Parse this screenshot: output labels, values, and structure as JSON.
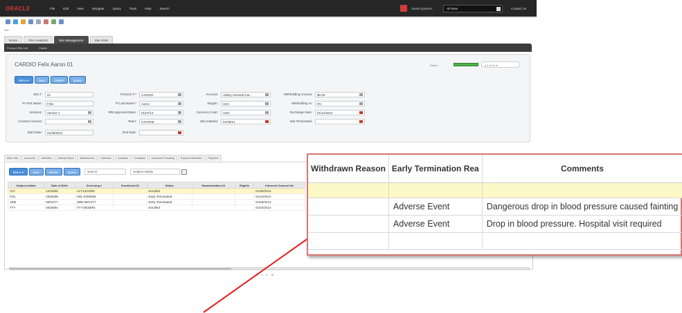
{
  "topbar": {
    "logo": "ORACLE",
    "menu": [
      "File",
      "Edit",
      "View",
      "Navigate",
      "Query",
      "Tools",
      "Help",
      "Search"
    ],
    "saved_queries_label": "Saved Queries:",
    "sites_value": "All Sites",
    "contact": "Contact Us"
  },
  "site_label": "Site",
  "main_tabs": [
    "Home",
    "OSA Analytics",
    "Site Management",
    "Site Visits"
  ],
  "sub_tabs": [
    "Protocol Site List",
    "Charts"
  ],
  "record": {
    "title": "CARDIO Felix Aaron 01",
    "status_label": "Status:",
    "pager": "1 of 1+",
    "buttons": {
      "menu": "Menu",
      "new": "New",
      "delete": "Delete",
      "query": "Query"
    }
  },
  "fields": {
    "site_no": {
      "label": "Site #:",
      "value": "01"
    },
    "pi_first": {
      "label": "PI First Name:",
      "value": "Felix"
    },
    "versions": {
      "label": "Versions:",
      "value": "Version 1"
    },
    "contract_amount": {
      "label": "Contract Amount:",
      "value": ""
    },
    "start_date": {
      "label": "Start Date:",
      "value": "01/08/2014"
    },
    "protocol": {
      "label": "Protocol #:",
      "value": "CARDIO"
    },
    "pi_last": {
      "label": "PI Last Name:",
      "value": "Aaron"
    },
    "irb_approval": {
      "label": "IRB Approval Dates:",
      "value": "01/07/14"
    },
    "team": {
      "label": "Team:",
      "value": "CSTONE"
    },
    "end_date": {
      "label": "End Date:",
      "value": ""
    },
    "account": {
      "label": "Account:",
      "value": "Abbey General Car..."
    },
    "region": {
      "label": "Region:",
      "value": "USA"
    },
    "currency": {
      "label": "Currency Code:",
      "value": "USD"
    },
    "site_initiated": {
      "label": "Site Initiated:",
      "value": "01/08/14"
    },
    "withholding_amount": {
      "label": "Withholding Amount:",
      "value": "$0.00"
    },
    "withholding_pct": {
      "label": "Withholding %:",
      "value": "0%"
    },
    "exchange_date": {
      "label": "Exchange Date:",
      "value": "01/12/2014"
    },
    "site_terminated": {
      "label": "Site Terminated:",
      "value": ""
    }
  },
  "lower_tabs": [
    "More Info",
    "Accounts",
    "Activities",
    "Activity Plans",
    "Attachments",
    "Calendar",
    "Contacts",
    "Contracts",
    "Document Tracking",
    "Payment Activities",
    "Payment"
  ],
  "grid": {
    "search_label": "Search",
    "subject_select": "Subject Initials",
    "columns": [
      "Subject Initials",
      "Date of Birth",
      "Screening #",
      "Enrollment ID",
      "Status",
      "Randomization ID",
      "Eligible",
      "Informed Consent Da"
    ],
    "rows": [
      [
        "ALT",
        "12/23/85",
        "ALT:12/23/85",
        "",
        "Enrolled",
        "",
        "",
        "01/05/2014"
      ],
      [
        "CRL",
        "03/05/88",
        "CRL:03/05/88",
        "",
        "Early Terminated",
        "",
        "",
        "01/10/2014"
      ],
      [
        "JWE",
        "09/12/77",
        "JWE:09/12/77",
        "",
        "Early Terminated",
        "",
        "",
        "01/08/2014"
      ],
      [
        "TTY",
        "06/28/84",
        "TTY:06/28/84",
        "",
        "Enrolled",
        "",
        "",
        "01/04/2014"
      ]
    ]
  },
  "zoom": {
    "columns": [
      "Withdrawn Reason",
      "Early Termination Rea",
      "Comments"
    ],
    "rows": [
      [
        "",
        "",
        ""
      ],
      [
        "",
        "Adverse Event",
        "Dangerous drop in blood pressure caused fainting"
      ],
      [
        "",
        "Adverse Event",
        "Drop in blood pressure.  Hospital visit required"
      ],
      [
        "",
        "",
        ""
      ]
    ]
  },
  "colors": {
    "accent": "#4a8fd9",
    "status_green": "#4fb34b",
    "callout_border": "#d8766e",
    "selected_row": "#fdf8c7",
    "arrow": "#e0201f"
  }
}
